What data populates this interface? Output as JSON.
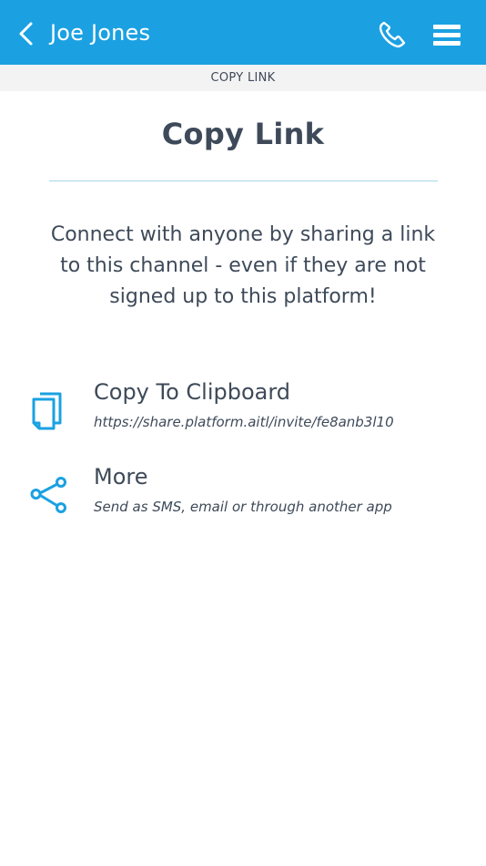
{
  "header": {
    "title": "Joe Jones",
    "background_color": "#1ba1e2",
    "icons": [
      "chevron-left-icon",
      "phone-icon",
      "hamburger-menu-icon"
    ]
  },
  "subheader": {
    "label": "COPY LINK"
  },
  "main": {
    "heading": "Copy Link",
    "description": "Connect with anyone by sharing a link to this channel - even if they are not signed up to this platform!",
    "options": [
      {
        "title": "Copy To Clipboard",
        "subtitle": "https://share.platform.aitl/invite/fe8anb3l10",
        "icon": "clipboard-copy-icon"
      },
      {
        "title": "More",
        "subtitle": "Send as SMS, email or through another app",
        "icon": "share-icon"
      }
    ]
  },
  "accent_color": "#1ba1e2"
}
